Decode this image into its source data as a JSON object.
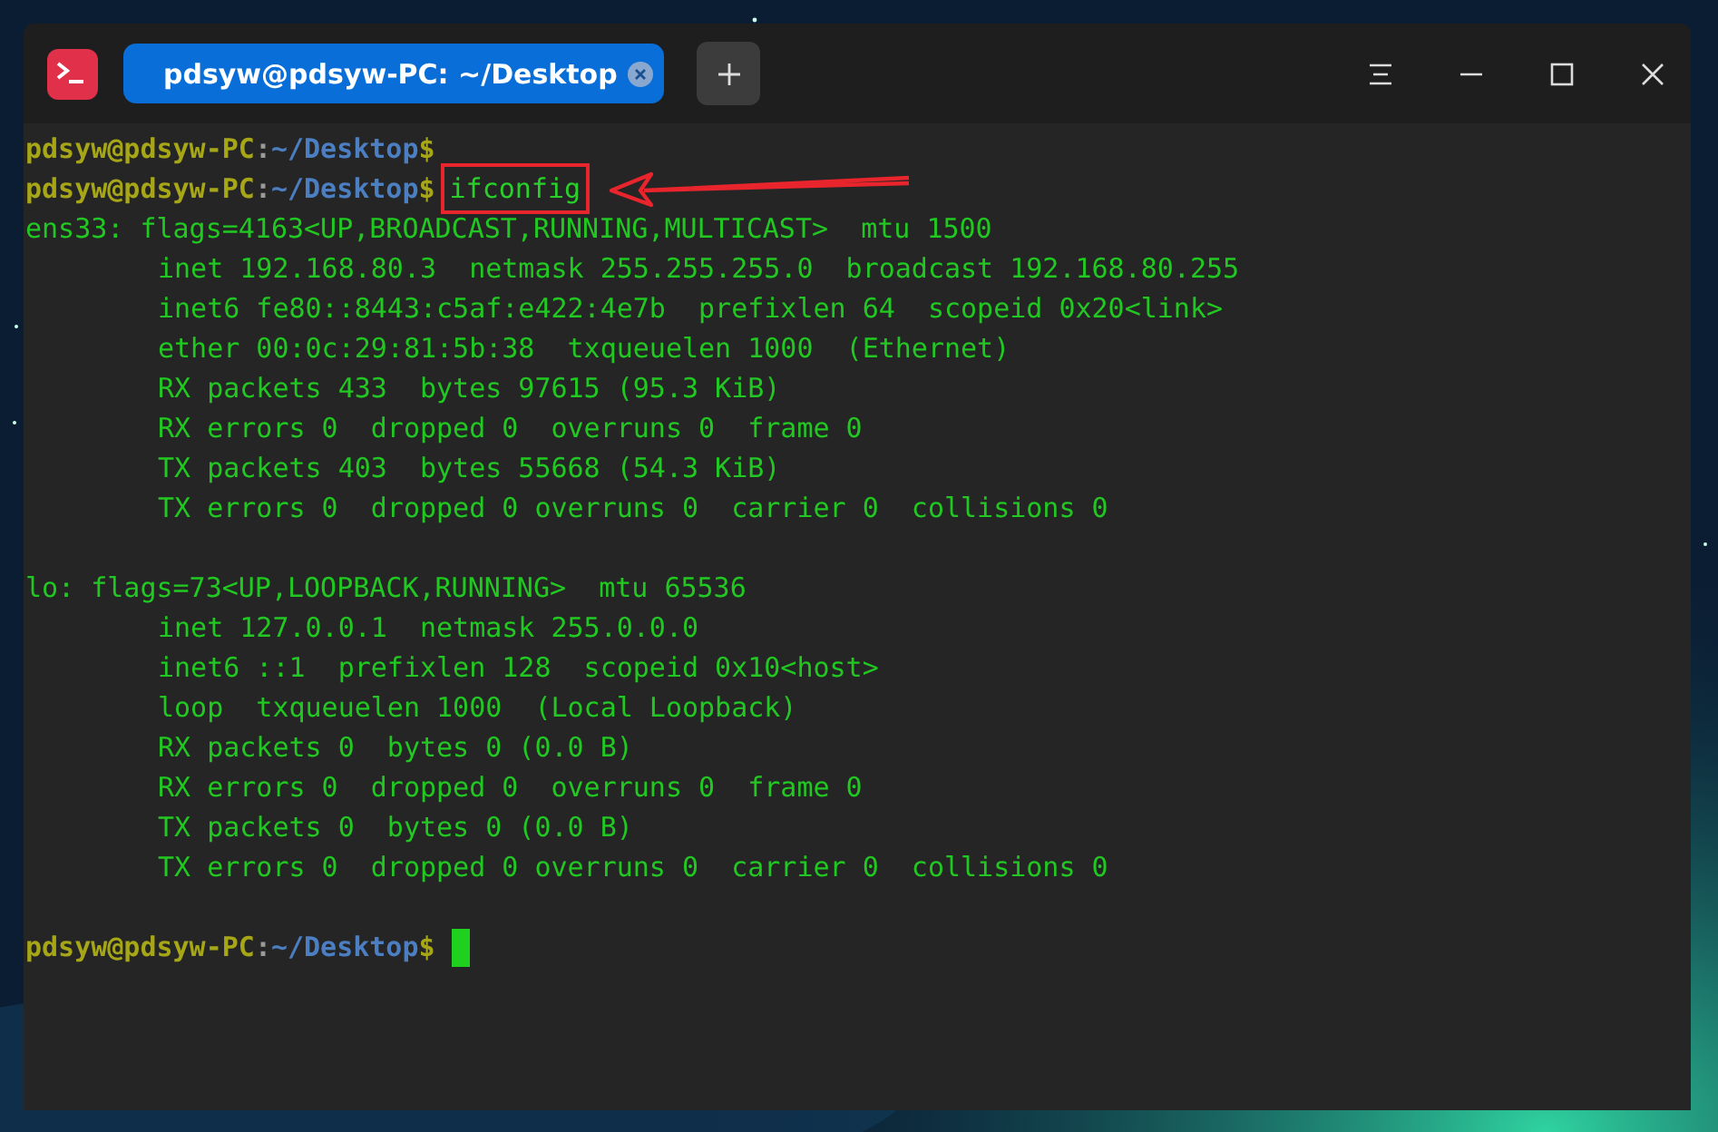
{
  "window": {
    "tab": {
      "title": "pdsyw@pdsyw-PC: ~/Desktop",
      "selected": true
    }
  },
  "terminal": {
    "lines": [
      {
        "kind": "prompt",
        "user_host": "pdsyw@pdsyw-PC",
        "separator": ":",
        "path": "~/Desktop",
        "symbol": "$"
      },
      {
        "kind": "prompt",
        "user_host": "pdsyw@pdsyw-PC",
        "separator": ":",
        "path": "~/Desktop",
        "symbol": "$",
        "command": "ifconfig",
        "highlighted": true
      },
      {
        "kind": "output",
        "text": "ens33: flags=4163<UP,BROADCAST,RUNNING,MULTICAST>  mtu 1500",
        "children": [
          {
            "text": "inet 192.168.80.3  netmask 255.255.255.0  broadcast 192.168.80.255"
          },
          {
            "text": "inet6 fe80::8443:c5af:e422:4e7b  prefixlen 64  scopeid 0x20<link>"
          },
          {
            "text": "ether 00:0c:29:81:5b:38  txqueuelen 1000  (Ethernet)"
          },
          {
            "text": "RX packets 433  bytes 97615 (95.3 KiB)"
          },
          {
            "text": "RX errors 0  dropped 0  overruns 0  frame 0"
          },
          {
            "text": "TX packets 403  bytes 55668 (54.3 KiB)"
          },
          {
            "text": "TX errors 0  dropped 0 overruns 0  carrier 0  collisions 0"
          }
        ]
      },
      {
        "kind": "blank"
      },
      {
        "kind": "output",
        "text": "lo: flags=73<UP,LOOPBACK,RUNNING>  mtu 65536",
        "children": [
          {
            "text": "inet 127.0.0.1  netmask 255.0.0.0"
          },
          {
            "text": "inet6 ::1  prefixlen 128  scopeid 0x10<host>"
          },
          {
            "text": "loop  txqueuelen 1000  (Local Loopback)"
          },
          {
            "text": "RX packets 0  bytes 0 (0.0 B)"
          },
          {
            "text": "RX errors 0  dropped 0  overruns 0  frame 0"
          },
          {
            "text": "TX packets 0  bytes 0 (0.0 B)"
          },
          {
            "text": "TX errors 0  dropped 0 overruns 0  carrier 0  collisions 0"
          }
        ]
      },
      {
        "kind": "blank"
      },
      {
        "kind": "prompt",
        "user_host": "pdsyw@pdsyw-PC",
        "separator": ":",
        "path": "~/Desktop",
        "symbol": "$",
        "cursor": true
      }
    ]
  }
}
